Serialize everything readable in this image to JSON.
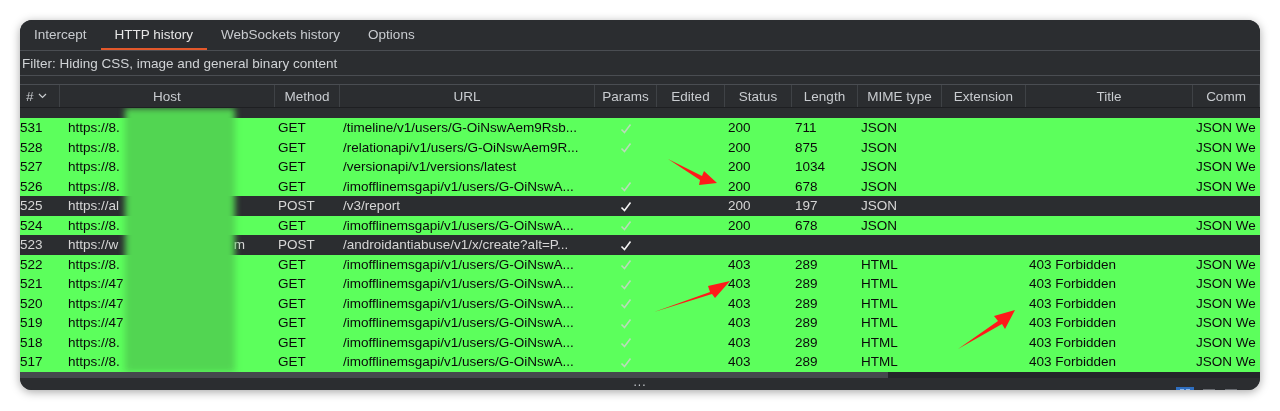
{
  "tabs": [
    {
      "label": "Intercept",
      "selected": false
    },
    {
      "label": "HTTP history",
      "selected": true
    },
    {
      "label": "WebSockets history",
      "selected": false
    },
    {
      "label": "Options",
      "selected": false
    }
  ],
  "filter": "Filter: Hiding CSS, image and general binary content",
  "table": {
    "columns": [
      {
        "label": "#",
        "sorted": true
      },
      {
        "label": "Host",
        "sorted": false
      },
      {
        "label": "Method",
        "sorted": false
      },
      {
        "label": "URL",
        "sorted": false
      },
      {
        "label": "Params",
        "sorted": false
      },
      {
        "label": "Edited",
        "sorted": false
      },
      {
        "label": "Status",
        "sorted": false
      },
      {
        "label": "Length",
        "sorted": false
      },
      {
        "label": "MIME type",
        "sorted": false
      },
      {
        "label": "Extension",
        "sorted": false
      },
      {
        "label": "Title",
        "sorted": false
      },
      {
        "label": "Comm",
        "sorted": false
      }
    ],
    "rows": [
      {
        "number": "531",
        "host": "https://8.",
        "method": "GET",
        "url": "/timeline/v1/users/G-OiNswAem9Rsb...",
        "params": true,
        "status": "200",
        "length": "711",
        "mime": "JSON",
        "title": "",
        "comment": "JSON We",
        "highlighted": true
      },
      {
        "number": "528",
        "host": "https://8.",
        "method": "GET",
        "url": "/relationapi/v1/users/G-OiNswAem9R...",
        "params": true,
        "status": "200",
        "length": "875",
        "mime": "JSON",
        "title": "",
        "comment": "JSON We",
        "highlighted": true
      },
      {
        "number": "527",
        "host": "https://8.",
        "method": "GET",
        "url": "/versionapi/v1/versions/latest",
        "params": false,
        "status": "200",
        "length": "1034",
        "mime": "JSON",
        "title": "",
        "comment": "JSON We",
        "highlighted": true
      },
      {
        "number": "526",
        "host": "https://8.",
        "method": "GET",
        "url": "/imofflinemsgapi/v1/users/G-OiNswA...",
        "params": true,
        "status": "200",
        "length": "678",
        "mime": "JSON",
        "title": "",
        "comment": "JSON We",
        "highlighted": true
      },
      {
        "number": "525",
        "host": "https://al",
        "method": "POST",
        "url": "/v3/report",
        "params": true,
        "status": "200",
        "length": "197",
        "mime": "JSON",
        "title": "",
        "comment": "",
        "highlighted": false
      },
      {
        "number": "524",
        "host": "https://8.",
        "method": "GET",
        "url": "/imofflinemsgapi/v1/users/G-OiNswA...",
        "params": true,
        "status": "200",
        "length": "678",
        "mime": "JSON",
        "title": "",
        "comment": "JSON We",
        "highlighted": true
      },
      {
        "number": "523",
        "host": "https://w",
        "host_tail": "m",
        "method": "POST",
        "url": "/androidantiabuse/v1/x/create?alt=P...",
        "params": true,
        "status": "",
        "length": "",
        "mime": "",
        "title": "",
        "comment": "",
        "highlighted": false
      },
      {
        "number": "522",
        "host": "https://8.",
        "method": "GET",
        "url": "/imofflinemsgapi/v1/users/G-OiNswA...",
        "params": true,
        "status": "403",
        "length": "289",
        "mime": "HTML",
        "title": "403 Forbidden",
        "comment": "JSON We",
        "highlighted": true
      },
      {
        "number": "521",
        "host": "https://47",
        "method": "GET",
        "url": "/imofflinemsgapi/v1/users/G-OiNswA...",
        "params": true,
        "status": "403",
        "length": "289",
        "mime": "HTML",
        "title": "403 Forbidden",
        "comment": "JSON We",
        "highlighted": true
      },
      {
        "number": "520",
        "host": "https://47",
        "method": "GET",
        "url": "/imofflinemsgapi/v1/users/G-OiNswA...",
        "params": true,
        "status": "403",
        "length": "289",
        "mime": "HTML",
        "title": "403 Forbidden",
        "comment": "JSON We",
        "highlighted": true
      },
      {
        "number": "519",
        "host": "https://47",
        "method": "GET",
        "url": "/imofflinemsgapi/v1/users/G-OiNswA...",
        "params": true,
        "status": "403",
        "length": "289",
        "mime": "HTML",
        "title": "403 Forbidden",
        "comment": "JSON We",
        "highlighted": true
      },
      {
        "number": "518",
        "host": "https://8.",
        "method": "GET",
        "url": "/imofflinemsgapi/v1/users/G-OiNswA...",
        "params": true,
        "status": "403",
        "length": "289",
        "mime": "HTML",
        "title": "403 Forbidden",
        "comment": "JSON We",
        "highlighted": true
      },
      {
        "number": "517",
        "host": "https://8.",
        "method": "GET",
        "url": "/imofflinemsgapi/v1/users/G-OiNswA...",
        "params": true,
        "status": "403",
        "length": "289",
        "mime": "HTML",
        "title": "403 Forbidden",
        "comment": "JSON We",
        "highlighted": true
      }
    ]
  },
  "status_bar": {
    "handle": "..."
  }
}
